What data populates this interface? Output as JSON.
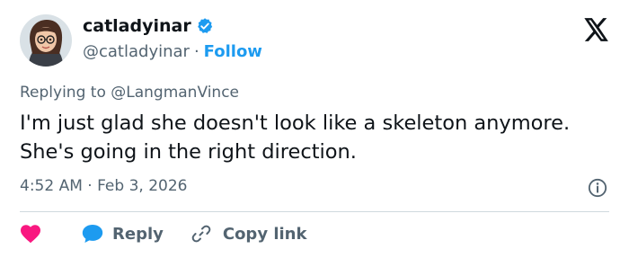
{
  "author": {
    "display_name": "catladyinar",
    "handle": "@catladyinar",
    "separator": "·",
    "follow_label": "Follow",
    "verified_icon": "verified-badge-icon",
    "avatar": "avatar"
  },
  "platform_icon": "x-logo-icon",
  "reply_context": {
    "prefix": "Replying to",
    "mention": "@LangmanVince"
  },
  "tweet": {
    "text": "I'm just glad she doesn't look like a skeleton anymore. She's going in the right direction.",
    "timestamp": "4:52 AM · Feb 3, 2026"
  },
  "actions": {
    "like_icon": "heart-icon",
    "reply_label": "Reply",
    "copy_link_label": "Copy link"
  },
  "colors": {
    "accent": "#1d9bf0",
    "heart": "#f91880",
    "text": "#0f1419",
    "secondary_text": "#536471",
    "divider": "#cfd9de"
  }
}
